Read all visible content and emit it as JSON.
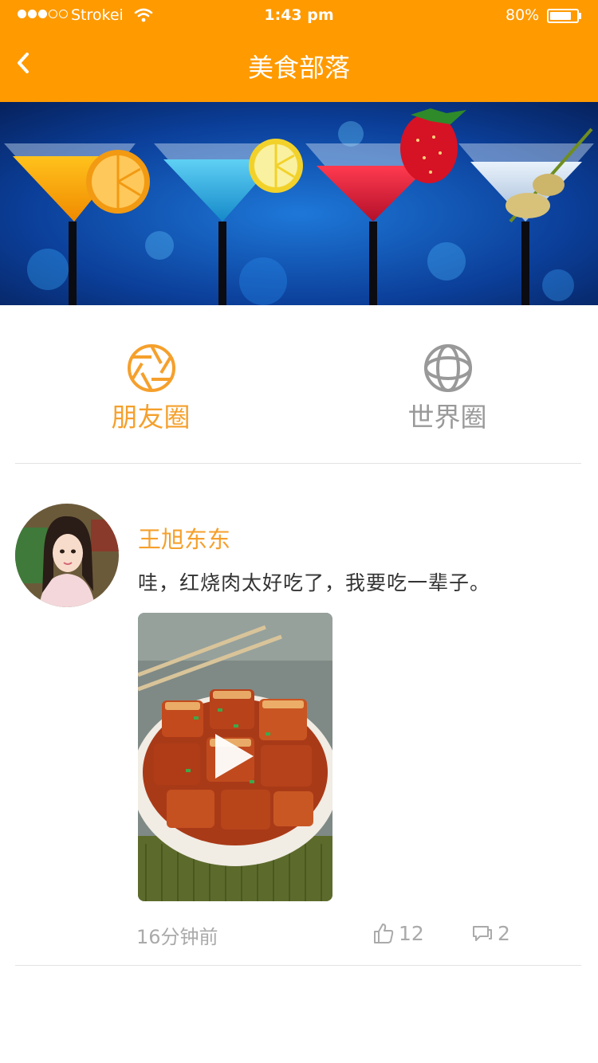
{
  "status_bar": {
    "carrier": "Strokei",
    "time": "1:43 pm",
    "battery": "80%",
    "battery_level": 0.8,
    "signal_bars_filled": 3,
    "signal_bars_total": 5
  },
  "nav": {
    "title": "美食部落",
    "back_icon": "chevron-left-icon"
  },
  "colors": {
    "header_bg": "#ff9a00",
    "accent": "#f5a02c",
    "inactive": "#999999",
    "meta": "#aaaaaa"
  },
  "tabs": [
    {
      "label": "朋友圈",
      "icon": "aperture-icon",
      "active": true
    },
    {
      "label": "世界圈",
      "icon": "globe-icon",
      "active": false
    }
  ],
  "post": {
    "author": "王旭东东",
    "text": "哇，红烧肉太好吃了，我要吃一辈子。",
    "media_type": "video",
    "time_ago": "16分钟前",
    "likes": "12",
    "comments": "2"
  }
}
